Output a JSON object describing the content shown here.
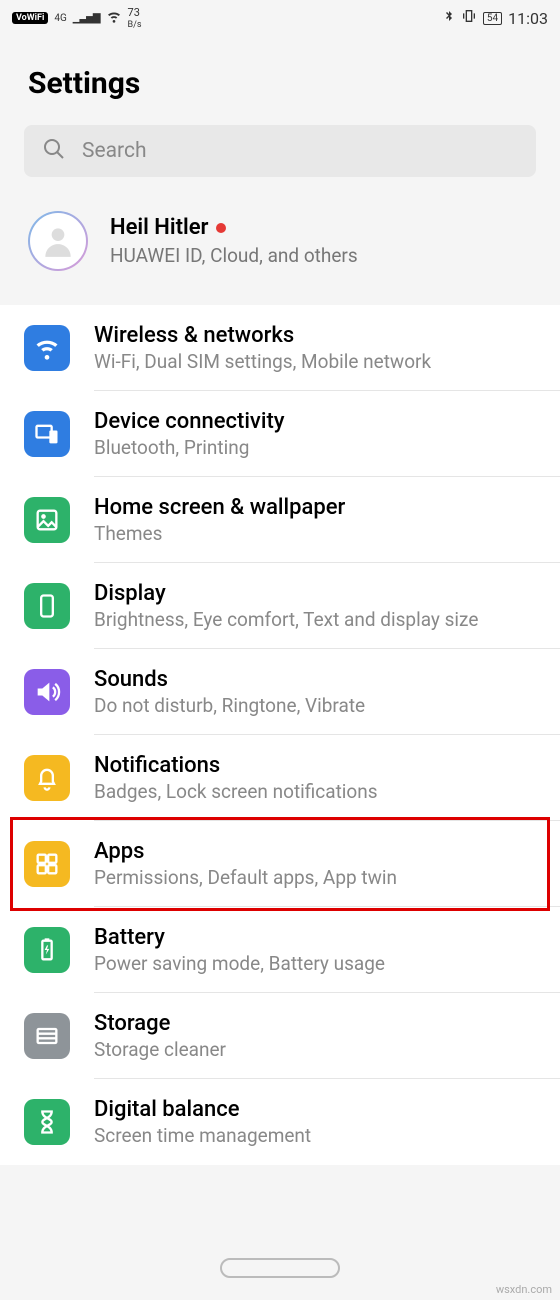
{
  "status_bar": {
    "vowifi": "VoWiFi",
    "signal": "4G",
    "speed_value": "73",
    "speed_unit": "B/s",
    "battery": "54",
    "time": "11:03"
  },
  "page_title": "Settings",
  "search": {
    "placeholder": "Search"
  },
  "account": {
    "name": "Heil Hitler",
    "sub": "HUAWEI ID, Cloud, and others"
  },
  "items": [
    {
      "title": "Wireless & networks",
      "sub": "Wi-Fi, Dual SIM settings, Mobile network",
      "icon": "wifi-icon",
      "bg": "#2f7de1"
    },
    {
      "title": "Device connectivity",
      "sub": "Bluetooth, Printing",
      "icon": "devices-icon",
      "bg": "#2f7de1"
    },
    {
      "title": "Home screen & wallpaper",
      "sub": "Themes",
      "icon": "home-wallpaper-icon",
      "bg": "#2db26a"
    },
    {
      "title": "Display",
      "sub": "Brightness, Eye comfort, Text and display size",
      "icon": "display-icon",
      "bg": "#2db26a"
    },
    {
      "title": "Sounds",
      "sub": "Do not disturb, Ringtone, Vibrate",
      "icon": "sounds-icon",
      "bg": "#8a5de8"
    },
    {
      "title": "Notifications",
      "sub": "Badges, Lock screen notifications",
      "icon": "notifications-icon",
      "bg": "#f5b921"
    },
    {
      "title": "Apps",
      "sub": "Permissions, Default apps, App twin",
      "icon": "apps-icon",
      "bg": "#f5b921"
    },
    {
      "title": "Battery",
      "sub": "Power saving mode, Battery usage",
      "icon": "battery-icon",
      "bg": "#2db26a"
    },
    {
      "title": "Storage",
      "sub": "Storage cleaner",
      "icon": "storage-icon",
      "bg": "#8e9499"
    },
    {
      "title": "Digital balance",
      "sub": "Screen time management",
      "icon": "digital-balance-icon",
      "bg": "#2db26a"
    }
  ],
  "highlighted_index": 6,
  "watermark": "wsxdn.com"
}
